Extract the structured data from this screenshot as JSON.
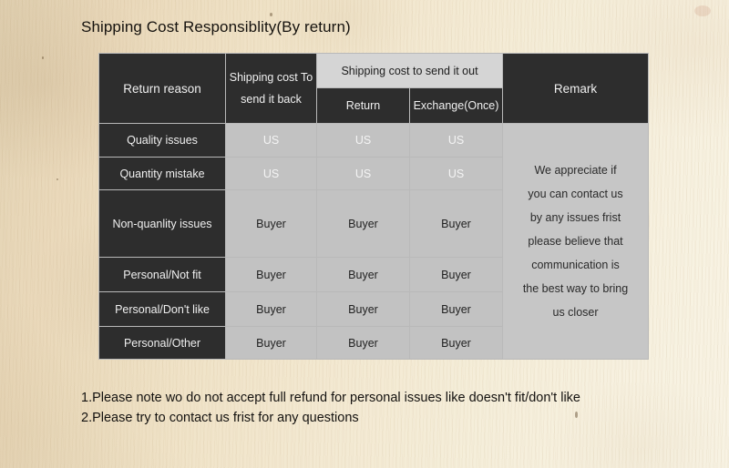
{
  "page": {
    "title": "Shipping Cost Responsiblity(By return)",
    "background_color": "#f0e3c8",
    "accent_dark": "#2d2d2d",
    "accent_gray": "#c2c2c2"
  },
  "table": {
    "headers": {
      "return_reason": "Return reason",
      "shipping_cost_back_line1": "Shipping cost",
      "shipping_cost_back_line2": "To send it back",
      "shipping_cost_out": "Shipping cost to send it out",
      "sub_return": "Return",
      "sub_exchange": "Exchange(Once)",
      "remark": "Remark"
    },
    "rows": [
      {
        "reason": "Quality issues",
        "send_back": "US",
        "return": "US",
        "exchange": "US"
      },
      {
        "reason": "Quantity mistake",
        "send_back": "US",
        "return": "US",
        "exchange": "US"
      },
      {
        "reason": "Non-quanlity issues",
        "send_back": "Buyer",
        "return": "Buyer",
        "exchange": "Buyer"
      },
      {
        "reason": "Personal/Not fit",
        "send_back": "Buyer",
        "return": "Buyer",
        "exchange": "Buyer"
      },
      {
        "reason": "Personal/Don't like",
        "send_back": "Buyer",
        "return": "Buyer",
        "exchange": "Buyer"
      },
      {
        "reason": "Personal/Other",
        "send_back": "Buyer",
        "return": "Buyer",
        "exchange": "Buyer"
      }
    ],
    "remark_lines": [
      "We appreciate if",
      "you can contact us",
      "by any issues frist",
      "please believe that",
      "communication is",
      "the best way to bring",
      "us closer"
    ]
  },
  "notes": [
    "1.Please note wo do not accept full refund for personal issues like doesn't fit/don't like",
    "2.Please try to contact us frist for any questions"
  ]
}
